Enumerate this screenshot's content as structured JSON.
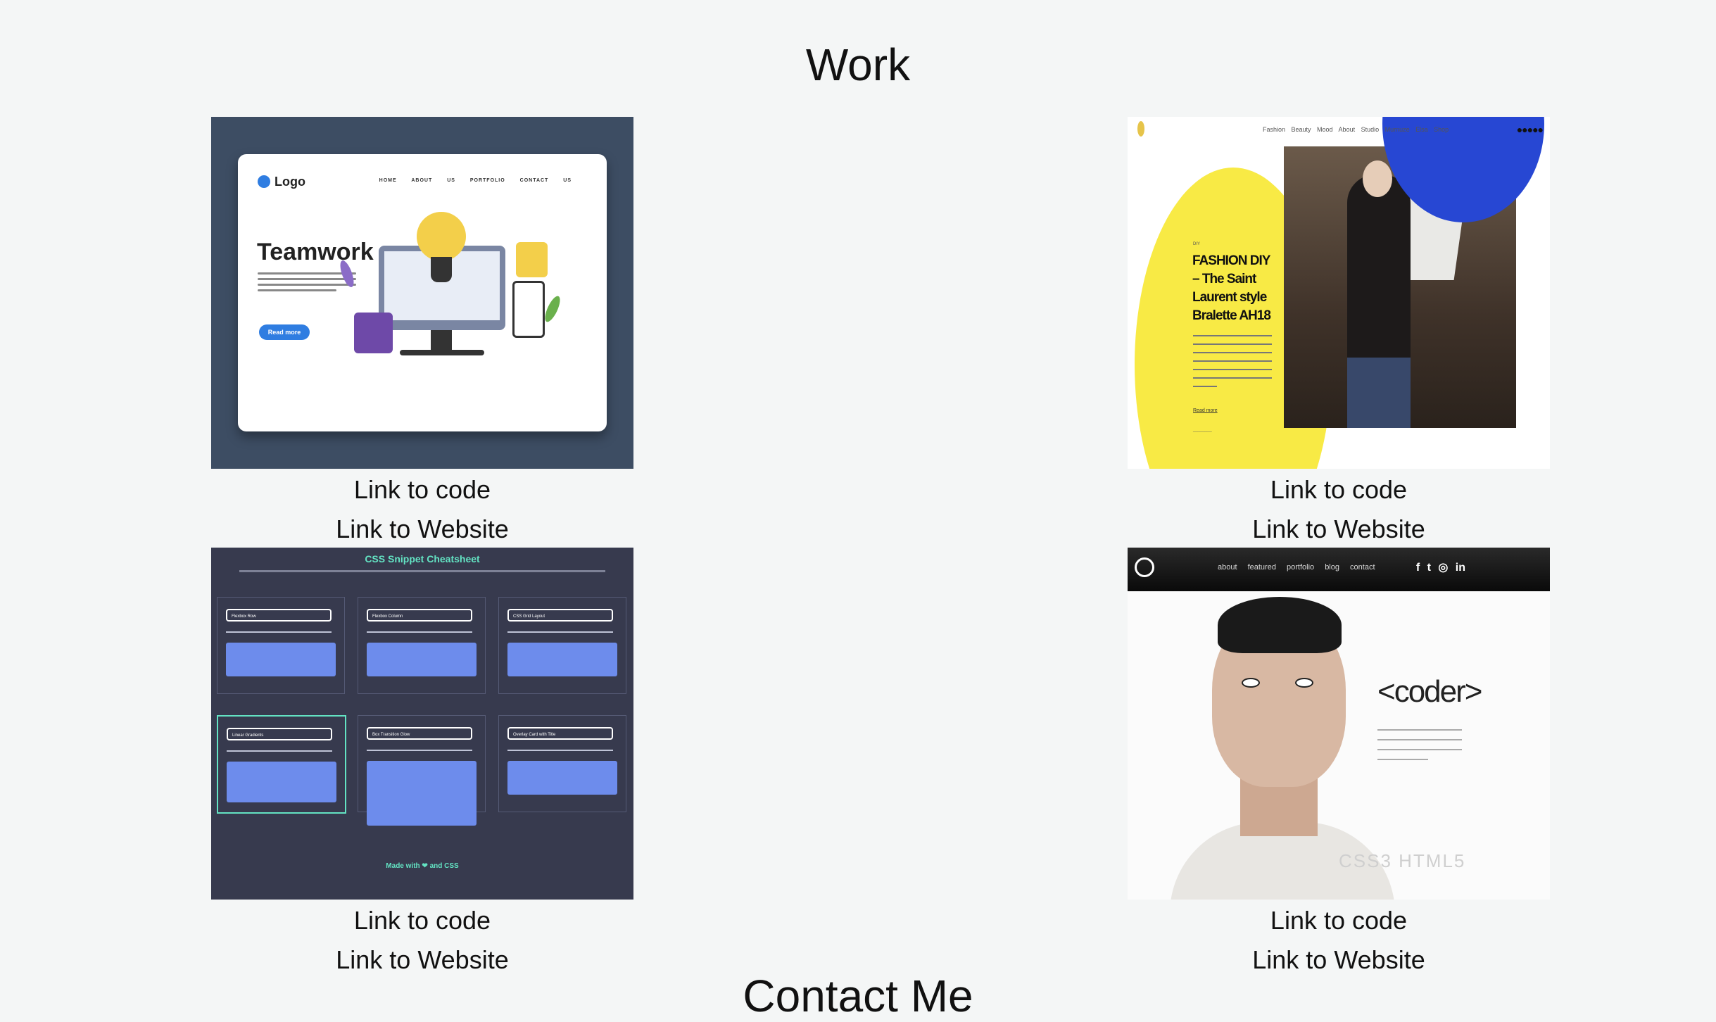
{
  "section_title": "Work",
  "next_section_title": "Contact Me",
  "projects": [
    {
      "code_link": "Link to code",
      "website_link": "Link to Website",
      "thumbnail": {
        "logo": "Logo",
        "nav": "HOME ABOUT US PORTFOLIO CONTACT US",
        "headline": "Teamwork",
        "button": "Read more"
      }
    },
    {
      "code_link": "Link to code",
      "website_link": "Link to Website",
      "thumbnail": {
        "nav": "Fashion Beauty Mood About Studio Murnuze Elsa Shop",
        "icons": "●●●●●",
        "category": "DIY",
        "headline": "FASHION DIY – The Saint Laurent style Bralette AH18",
        "read_more": "Read more"
      }
    },
    {
      "code_link": "Link to code",
      "website_link": "Link to Website",
      "thumbnail": {
        "title": "CSS Snippet Cheatsheet",
        "cells": [
          "Flexbox Row",
          "Flexbox Column",
          "CSS Grid Layout",
          "Linear Gradients",
          "Box Transition Glow",
          "Overlay Card with Title"
        ],
        "footer": "Made with ❤ and CSS"
      }
    },
    {
      "code_link": "Link to code",
      "website_link": "Link to Website",
      "thumbnail": {
        "menu": "about featured portfolio blog contact",
        "social": "f t ◎ in",
        "brand": "<coder>",
        "watermark": "CSS3 HTML5"
      }
    }
  ]
}
